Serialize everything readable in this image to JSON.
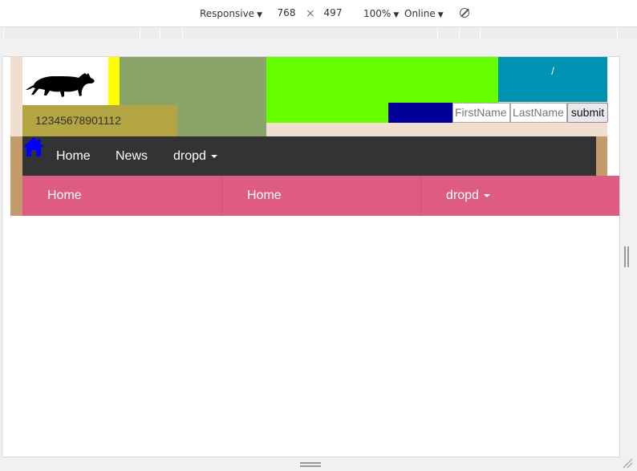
{
  "devtools": {
    "device": "Responsive",
    "width": "768",
    "times": "×",
    "height": "497",
    "zoom": "100%",
    "network": "Online",
    "icons": [
      "dropdown-caret-icon",
      "no-throttle-icon"
    ]
  },
  "header": {
    "logo": "cat-logo",
    "breadcrumb_left": "",
    "breadcrumb_sep": "/",
    "breadcrumb_right": "",
    "number_text": "12345678901112"
  },
  "form": {
    "firstname_placeholder": "FirstName",
    "lastname_placeholder": "LastName",
    "submit_label": "submit"
  },
  "dark_nav": {
    "home_icon": "home-icon",
    "items": [
      {
        "label": "Home"
      },
      {
        "label": "News"
      },
      {
        "label": "dropd"
      }
    ]
  },
  "pink_nav": {
    "items": [
      {
        "label": "Home"
      },
      {
        "label": "Home"
      },
      {
        "label": "dropd"
      }
    ]
  },
  "colors": {
    "tan": "#f0dfd0",
    "brown": "#c49a6c",
    "yellow": "#ffff00",
    "sage": "#8aa46a",
    "lime": "#66ff00",
    "teal": "#0092b3",
    "olive": "#b3a642",
    "navy": "#000099",
    "dark_nav": "#333333",
    "pink_nav": "#de5b82",
    "home_icon": "#0000ff"
  }
}
